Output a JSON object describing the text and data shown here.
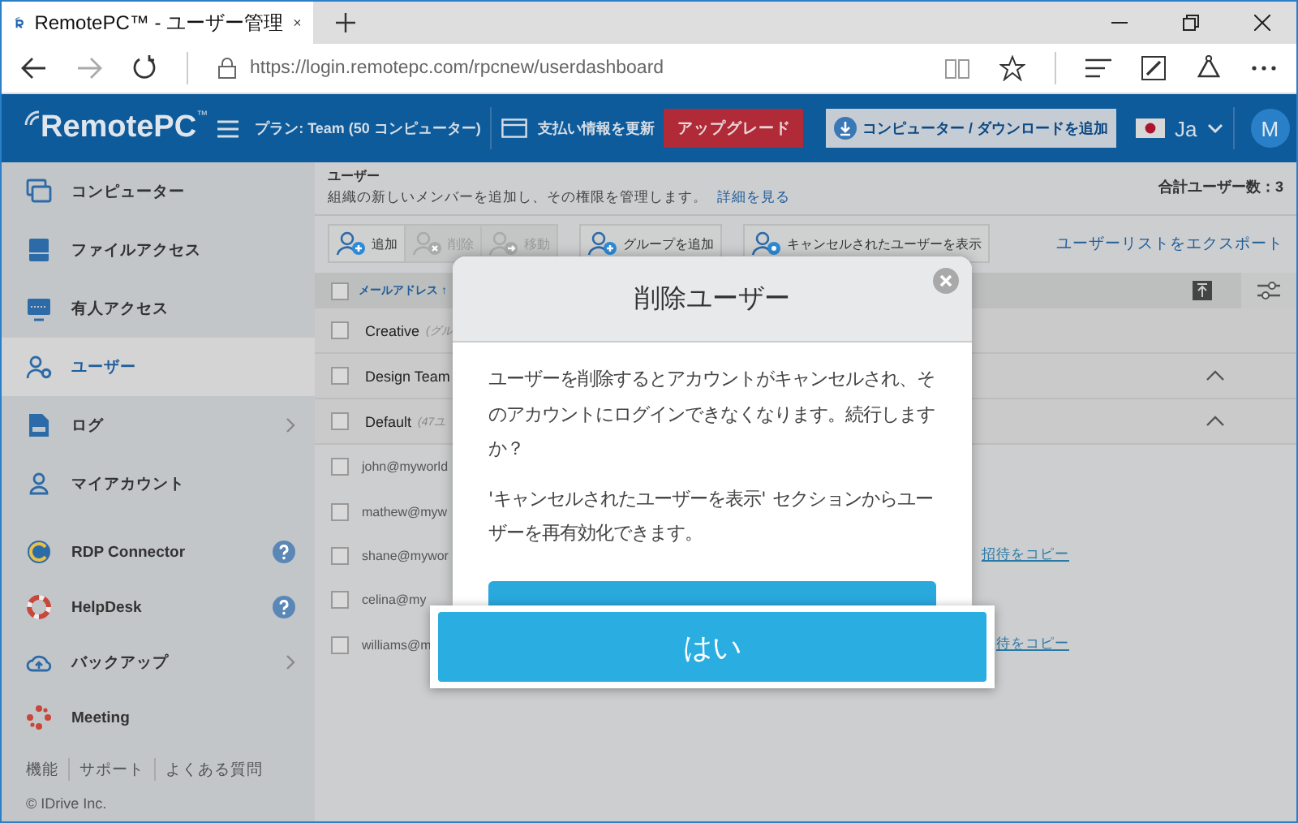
{
  "browser": {
    "tab_title": "RemotePC™ - ユーザー管理",
    "url": "https://login.remotepc.com/rpcnew/userdashboard"
  },
  "header": {
    "logo": "RemotePC",
    "logo_mark": "™",
    "plan": "プラン: Team (50 コンピューター)",
    "billing": "支払い情報を更新",
    "upgrade": "アップグレード",
    "add_computer": "コンピューター / ダウンロードを追加",
    "language": "Ja",
    "avatar": "M"
  },
  "sidebar": {
    "items": [
      {
        "label": "コンピューター",
        "selected": false,
        "expandable": false,
        "help": false
      },
      {
        "label": "ファイルアクセス",
        "selected": false,
        "expandable": false,
        "help": false
      },
      {
        "label": "有人アクセス",
        "selected": false,
        "expandable": false,
        "help": false
      },
      {
        "label": "ユーザー",
        "selected": true,
        "expandable": false,
        "help": false
      },
      {
        "label": "ログ",
        "selected": false,
        "expandable": true,
        "help": false
      },
      {
        "label": "マイアカウント",
        "selected": false,
        "expandable": false,
        "help": false
      },
      {
        "label": "RDP Connector",
        "selected": false,
        "expandable": false,
        "help": true
      },
      {
        "label": "HelpDesk",
        "selected": false,
        "expandable": false,
        "help": true
      },
      {
        "label": "バックアップ",
        "selected": false,
        "expandable": true,
        "help": false
      },
      {
        "label": "Meeting",
        "selected": false,
        "expandable": false,
        "help": false
      }
    ],
    "footer_links": [
      "機能",
      "サポート",
      "よくある質問"
    ],
    "copyright": "© IDrive Inc."
  },
  "page": {
    "title": "ユーザー",
    "description": "組織の新しいメンバーを追加し、その権限を管理します。",
    "details_link": "詳細を見る",
    "total": "合計ユーザー数：3"
  },
  "toolbar": {
    "buttons": [
      {
        "label": "追加",
        "disabled": false
      },
      {
        "label": "削除",
        "disabled": true
      },
      {
        "label": "移動",
        "disabled": true
      },
      {
        "label": "グループを追加",
        "disabled": false
      },
      {
        "label": "キャンセルされたユーザーを表示",
        "disabled": false
      }
    ],
    "export": "ユーザーリストをエクスポート"
  },
  "table": {
    "column": "メールアドレス ↑",
    "all_checked": false,
    "groups": [
      {
        "name": "Creative",
        "note": "(グル",
        "expanded": false,
        "checked": false
      },
      {
        "name": "Design Team",
        "expanded": true,
        "checked": false
      },
      {
        "name": "Default",
        "note": "(47ユ",
        "expanded": true,
        "checked": false
      }
    ],
    "users": [
      {
        "email": "john@myworld",
        "checked": false
      },
      {
        "email": "mathew@myw",
        "checked": false
      },
      {
        "email": "shane@mywor",
        "checked": false,
        "action": "招待をコピー"
      },
      {
        "email": "celina@my",
        "checked": false
      },
      {
        "email": "williams@m",
        "checked": false,
        "action": "待をコピー"
      }
    ]
  },
  "dialog": {
    "title": "削除ユーザー",
    "paragraphs": [
      "ユーザーを削除するとアカウントがキャンセルされ、そのアカウントにログインできなくなります。続行しますか？",
      "'キャンセルされたユーザーを表示' セクションからユーザーを再有効化できます。"
    ],
    "confirm": "はい"
  }
}
